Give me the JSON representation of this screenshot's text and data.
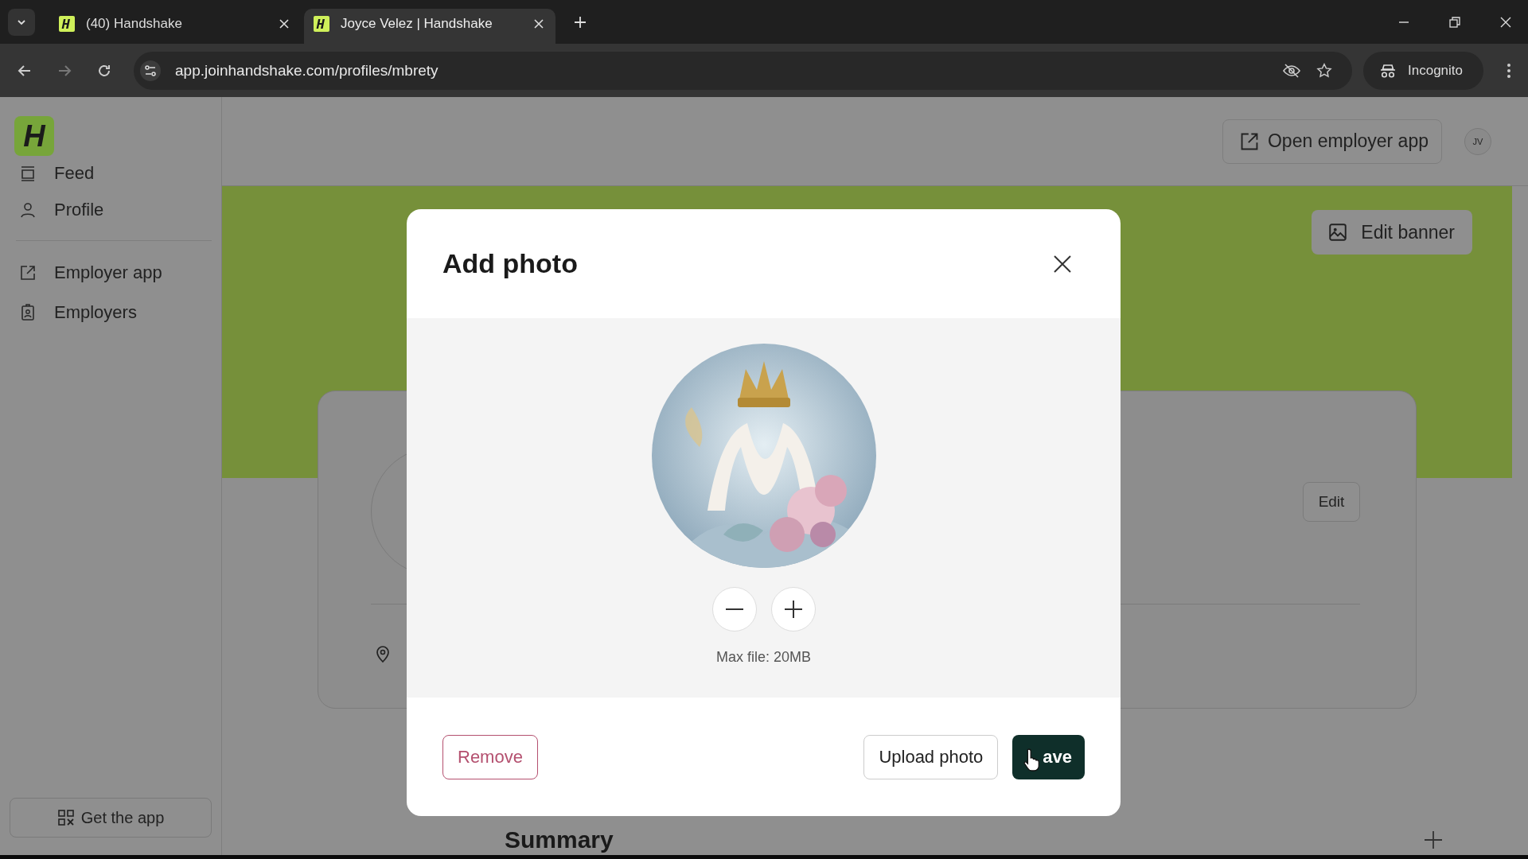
{
  "browser": {
    "tabs": [
      {
        "title": "(40) Handshake",
        "selected": false
      },
      {
        "title": "Joyce Velez | Handshake",
        "selected": true
      }
    ],
    "url": "app.joinhandshake.com/profiles/mbrety",
    "profile_label": "Incognito"
  },
  "sidebar": {
    "logo": "H",
    "groups": [
      [
        {
          "label": "Feed",
          "kind": "feed"
        },
        {
          "label": "Profile",
          "kind": "profile"
        }
      ],
      [
        {
          "label": "Employer app",
          "kind": "external"
        },
        {
          "label": "Employers",
          "kind": "badge"
        }
      ]
    ],
    "get_app": "Get the app"
  },
  "header": {
    "open_employer_app": "Open employer app",
    "avatar": "JV"
  },
  "banner": {
    "edit_banner": "Edit banner"
  },
  "profile_card": {
    "edit": "Edit"
  },
  "summary": {
    "title": "Summary"
  },
  "modal": {
    "title": "Add photo",
    "note": "Max file: 20MB",
    "buttons": [
      {
        "label": "Remove",
        "kind": "danger"
      },
      {
        "label": "Upload photo",
        "kind": "secondary"
      },
      {
        "label": "ave",
        "kind": "primary",
        "cursor": true
      }
    ]
  }
}
